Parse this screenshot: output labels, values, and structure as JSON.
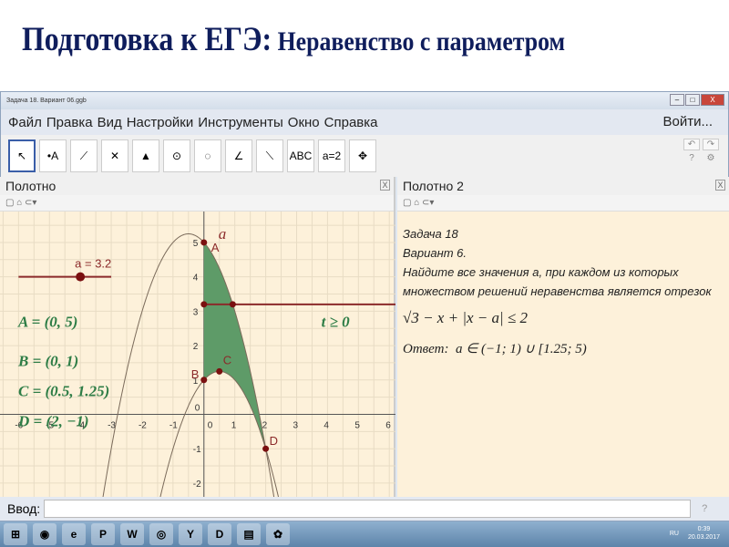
{
  "slide": {
    "title_main": "Подготовка к ЕГЭ:",
    "title_sub": " Неравенство с параметром"
  },
  "window": {
    "title": "Задача 18. Вариант 06.ggb",
    "min": "–",
    "max": "□",
    "close": "X"
  },
  "menu": {
    "items": [
      "Файл",
      "Правка",
      "Вид",
      "Настройки",
      "Инструменты",
      "Окно",
      "Справка"
    ],
    "login": "Войти..."
  },
  "toolbar": {
    "tools": [
      "↖",
      "•A",
      "⟋",
      "✕",
      "▲",
      "⊙",
      "◌",
      "∠",
      "⟍",
      "ABC",
      "a=2",
      "✥"
    ],
    "undo": "↶",
    "redo": "↷",
    "help": "?",
    "settings": "⚙"
  },
  "panel1": {
    "title": "Полотно",
    "close": "X",
    "subtools": "▢ ⌂ ⊂▾"
  },
  "panel2": {
    "title": "Полотно 2",
    "close": "X",
    "subtools": "▢ ⌂ ⊂▾",
    "lines": [
      "Задача 18",
      "Вариант 6.",
      "Найдите все значения a, при каждом из которых",
      "множеством решений неравенства  является отрезок"
    ],
    "formula": "√3 − x + |x − a| ≤ 2",
    "answer_label": "Ответ:",
    "answer": "a ∈ (−1; 1) ∪ [1.25; 5)"
  },
  "graph": {
    "x_ticks": [
      -6,
      -5,
      -4,
      -3,
      -2,
      -1,
      0,
      1,
      2,
      3,
      4,
      5,
      6
    ],
    "y_ticks": [
      -2,
      -1,
      0,
      1,
      2,
      3,
      4,
      5
    ],
    "xlim": [
      -6.6,
      6.2
    ],
    "ylim": [
      -2.4,
      5.9
    ],
    "axis_label": "a",
    "upper_curve": {
      "formula": "a = 5 - x - x^2",
      "coeffs": [
        5,
        -1,
        -1
      ]
    },
    "lower_curve": {
      "formula": "a = 1 + x - x^2",
      "coeffs": [
        1,
        1,
        -1
      ]
    },
    "shade_range": [
      0,
      2
    ],
    "slider": {
      "label": "a = 3.2",
      "value": 3.2,
      "min": -6,
      "max": -3,
      "pos": -4,
      "y": 4
    },
    "points": [
      {
        "name": "A",
        "x": 0,
        "y": 5
      },
      {
        "name": "B",
        "x": 0,
        "y": 1
      },
      {
        "name": "C",
        "x": 0.5,
        "y": 1.25
      },
      {
        "name": "D",
        "x": 2,
        "y": -1
      }
    ],
    "coords": [
      "A = (0, 5)",
      "B = (0, 1)",
      "C = (0.5, 1.25)",
      "D = (2, −1)"
    ],
    "constraint": "t ≥ 0",
    "colors": {
      "fill": "#5e9b68",
      "curve": "#7a6a5a",
      "point": "#7a1010",
      "hline": "#8b2a2a",
      "text": "#2e7d46",
      "grid": "#e8dcc4"
    }
  },
  "input": {
    "label": "Ввод:",
    "value": "",
    "help": "?"
  },
  "taskbar": {
    "apps": [
      "⊞",
      "◉",
      "e",
      "P",
      "W",
      "◎",
      "Y",
      "D",
      "▤",
      "✿"
    ],
    "lang": "RU",
    "time": "0:39",
    "date": "20.03.2017"
  }
}
